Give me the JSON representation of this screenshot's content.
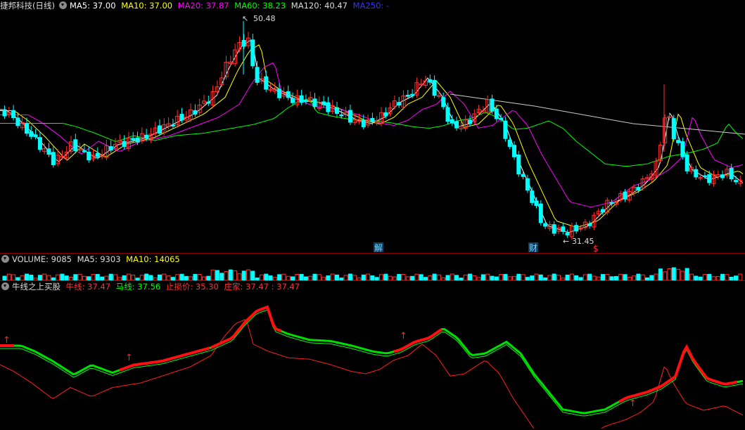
{
  "main": {
    "title": "捷邦科技(日线)",
    "ma5": "MA5: 37.00",
    "ma10": "MA10: 37.00",
    "ma20": "MA20: 37.87",
    "ma60": "MA60: 38.23",
    "ma120": "MA120: 40.47",
    "ma250": "MA250: -",
    "high_label": "50.48",
    "low_label": "31.45",
    "markers": [
      "解",
      "财",
      "$"
    ],
    "colors": {
      "ma5": "#ffffff",
      "ma10": "#ffff00",
      "ma20": "#ff00ff",
      "ma60": "#00ff00",
      "ma250": "#3333ff",
      "up": "#ff3030",
      "down": "#00ffff"
    }
  },
  "volume": {
    "title": "VOLUME: 9085",
    "ma5": "MA5: 9303",
    "ma10": "MA10: 14065"
  },
  "indicator": {
    "title": "牛线之上买股",
    "niu": "牛线: 37.47",
    "ma": "马线: 37.56",
    "stop": "止损价: 35.30",
    "zhuang": "庄家: 37.47",
    "extra": ": 37.47"
  }
}
